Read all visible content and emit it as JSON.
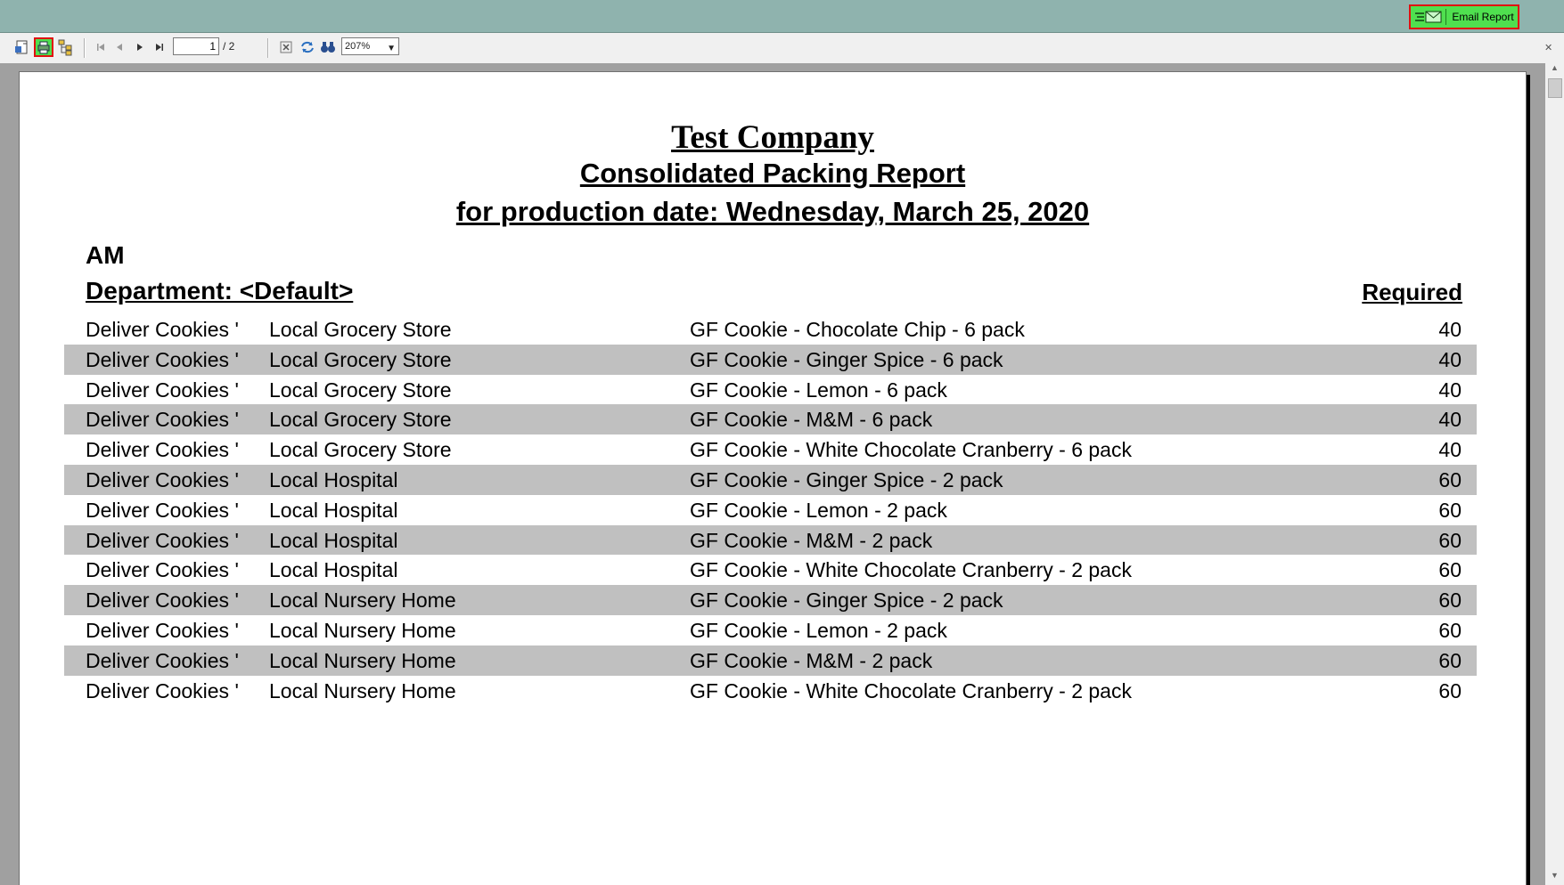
{
  "topbar": {
    "email_button_label": "Email Report"
  },
  "toolbar": {
    "current_page": "1",
    "total_pages": "/ 2",
    "zoom": "207%"
  },
  "report": {
    "company": "Test Company",
    "title": "Consolidated Packing Report",
    "production_date": "for production date: Wednesday, March 25, 2020",
    "shift": "AM",
    "department": "Department: <Default>",
    "required_header": "Required",
    "rows": [
      {
        "task": "Deliver Cookies '",
        "customer": "Local Grocery Store",
        "item": "GF Cookie - Chocolate Chip - 6 pack",
        "qty": "40"
      },
      {
        "task": "Deliver Cookies '",
        "customer": "Local Grocery Store",
        "item": "GF Cookie - Ginger Spice - 6 pack",
        "qty": "40"
      },
      {
        "task": "Deliver Cookies '",
        "customer": "Local Grocery Store",
        "item": "GF Cookie - Lemon - 6 pack",
        "qty": "40"
      },
      {
        "task": "Deliver Cookies '",
        "customer": "Local Grocery Store",
        "item": "GF Cookie - M&M - 6 pack",
        "qty": "40"
      },
      {
        "task": "Deliver Cookies '",
        "customer": "Local Grocery Store",
        "item": "GF Cookie - White Chocolate Cranberry - 6 pack",
        "qty": "40"
      },
      {
        "task": "Deliver Cookies '",
        "customer": "Local Hospital",
        "item": "GF Cookie - Ginger Spice - 2 pack",
        "qty": "60"
      },
      {
        "task": "Deliver Cookies '",
        "customer": "Local Hospital",
        "item": "GF Cookie - Lemon - 2 pack",
        "qty": "60"
      },
      {
        "task": "Deliver Cookies '",
        "customer": "Local Hospital",
        "item": "GF Cookie - M&M - 2 pack",
        "qty": "60"
      },
      {
        "task": "Deliver Cookies '",
        "customer": "Local Hospital",
        "item": "GF Cookie - White Chocolate Cranberry - 2 pack",
        "qty": "60"
      },
      {
        "task": "Deliver Cookies '",
        "customer": "Local Nursery Home",
        "item": "GF Cookie - Ginger Spice - 2 pack",
        "qty": "60"
      },
      {
        "task": "Deliver Cookies '",
        "customer": "Local Nursery Home",
        "item": "GF Cookie - Lemon - 2 pack",
        "qty": "60"
      },
      {
        "task": "Deliver Cookies '",
        "customer": "Local Nursery Home",
        "item": "GF Cookie - M&M - 2 pack",
        "qty": "60"
      },
      {
        "task": "Deliver Cookies '",
        "customer": "Local Nursery Home",
        "item": "GF Cookie - White Chocolate Cranberry - 2 pack",
        "qty": "60"
      }
    ]
  }
}
